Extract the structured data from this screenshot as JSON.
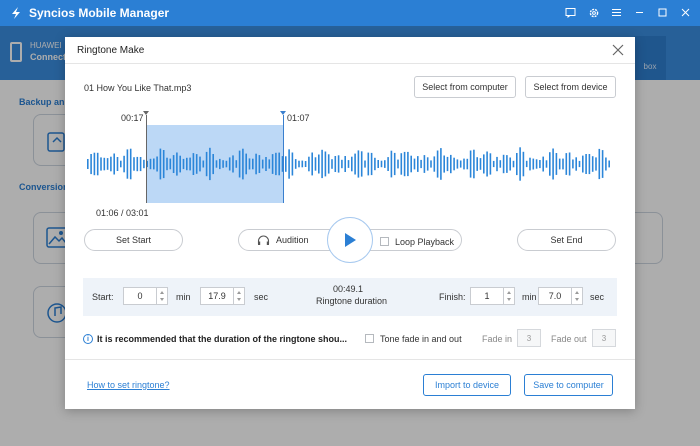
{
  "app": {
    "title": "Syncios Mobile Manager",
    "accent": "#2b7fd4"
  },
  "background": {
    "device_name": "HUAWEI",
    "device_status": "Connect",
    "toolbox_label": "box",
    "section_backup": "Backup an",
    "section_conversion": "Conversion"
  },
  "dialog": {
    "title": "Ringtone Make",
    "file_name": "01 How You Like That.mp3",
    "select_computer": "Select from computer",
    "select_device": "Select from device",
    "marker_start": "00:17",
    "marker_end": "01:07",
    "position": "01:06 / 03:01",
    "set_start": "Set Start",
    "audition": "Audition",
    "loop_playback": "Loop Playback",
    "set_end": "Set End",
    "start_label": "Start:",
    "start_min": "0",
    "min_unit": "min",
    "start_sec": "17.9",
    "sec_unit": "sec",
    "duration_value": "00:49.1",
    "duration_label": "Ringtone duration",
    "finish_label": "Finish:",
    "finish_min": "1",
    "finish_min_unit": "min",
    "finish_sec": "7.0",
    "finish_sec_unit": "sec",
    "note": "It is recommended that the duration of the ringtone shou...",
    "tone_fade": "Tone fade in and out",
    "fade_in_label": "Fade in",
    "fade_in_value": "3",
    "fade_out_label": "Fade out",
    "fade_out_value": "3",
    "how_to_link": "How to set ringtone?",
    "import_device": "Import to device",
    "save_computer": "Save to computer"
  },
  "icons": {
    "logo": "syncios-logo-icon",
    "feedback": "message-icon",
    "settings": "gear-icon",
    "menu": "menu-icon",
    "minimize": "minimize-icon",
    "maximize": "maximize-icon",
    "close": "close-icon",
    "play": "play-icon",
    "headphones": "headphones-icon",
    "info": "info-icon"
  }
}
